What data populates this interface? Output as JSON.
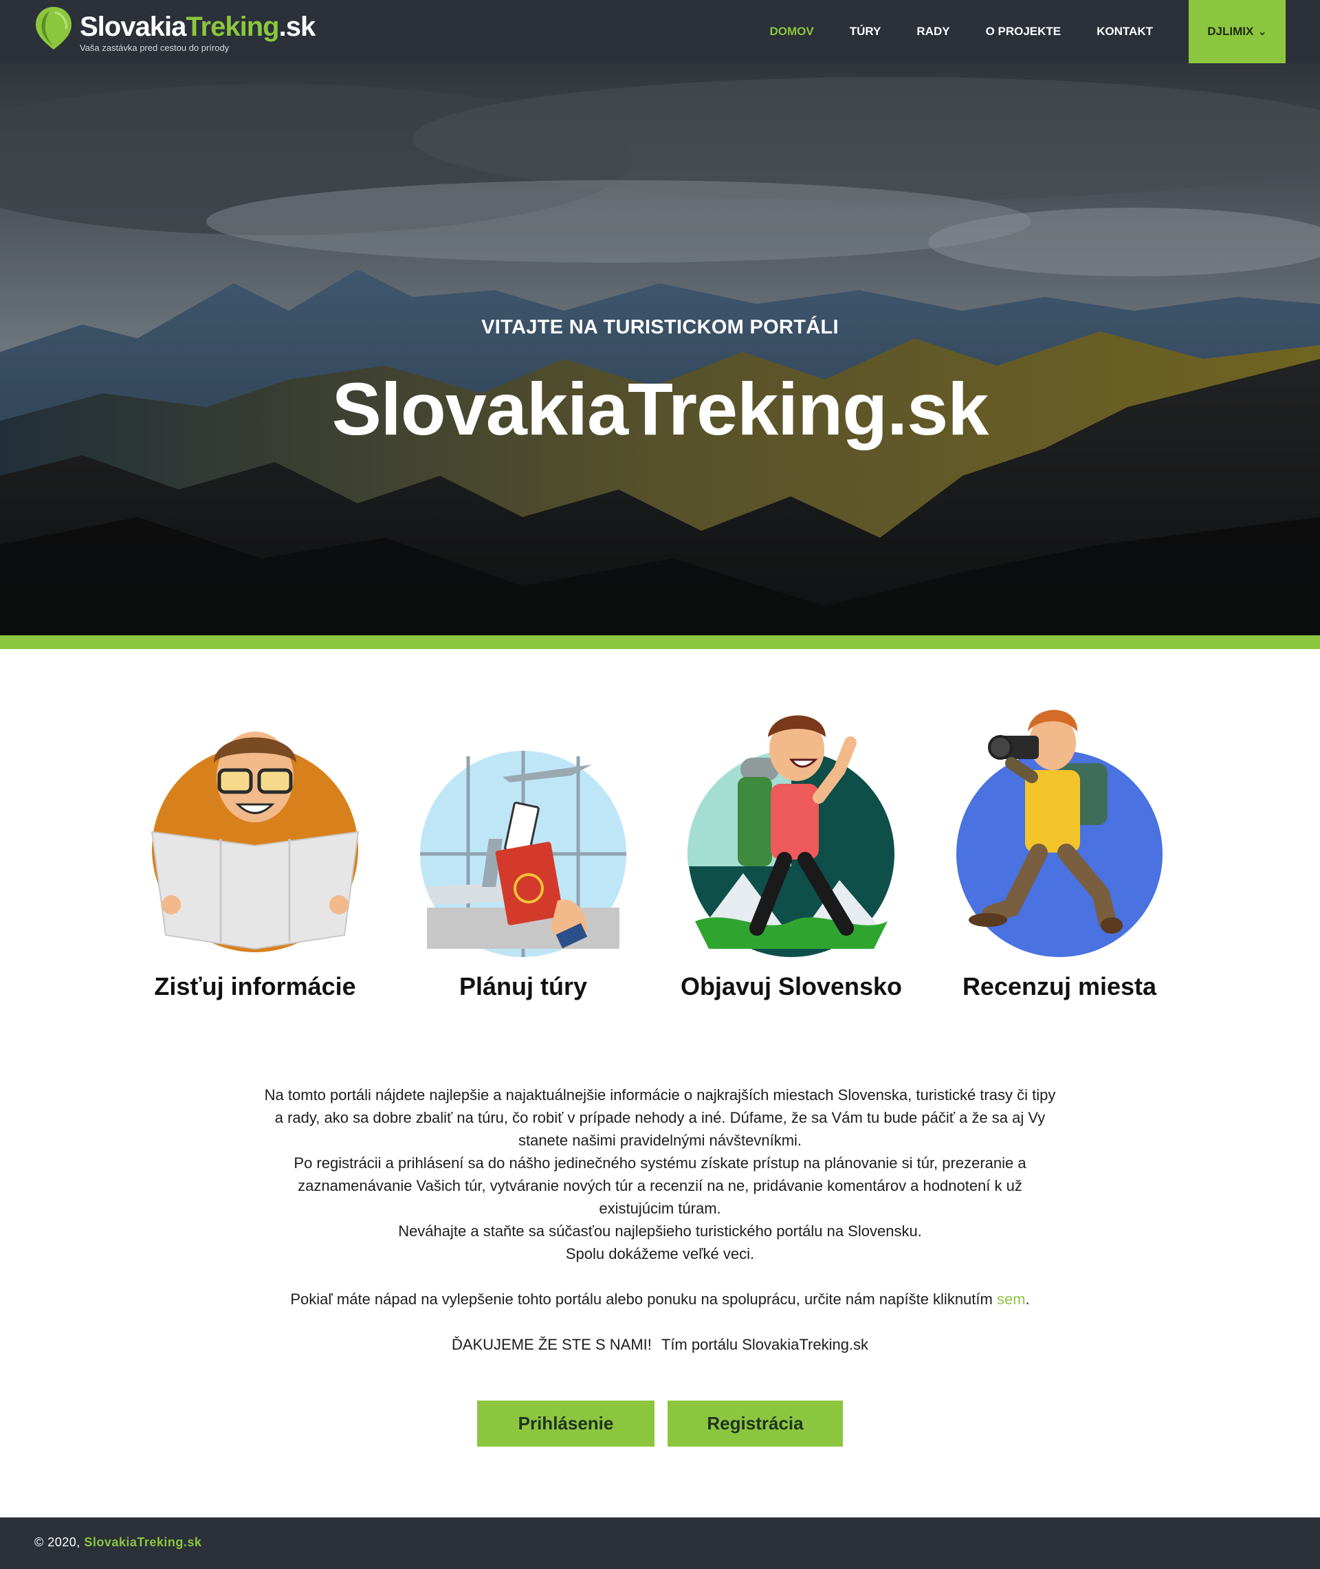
{
  "brand": {
    "name_part1": "Slovakia",
    "name_part2": "Treking",
    "name_part3": ".sk",
    "tagline": "Vaša zastávka pred cestou do prírody"
  },
  "nav": {
    "items": [
      "DOMOV",
      "TÚRY",
      "RADY",
      "O PROJEKTE",
      "KONTAKT"
    ],
    "active": "DOMOV",
    "user": "DJLIMIX"
  },
  "hero": {
    "subtitle": "VITAJTE NA TURISTICKOM PORTÁLI",
    "title": "SlovakiaTreking.sk"
  },
  "features": [
    {
      "label": "Zisťuj informácie",
      "icon": "reading-map-icon"
    },
    {
      "label": "Plánuj túry",
      "icon": "passport-ticket-icon"
    },
    {
      "label": "Objavuj Slovensko",
      "icon": "hiker-icon"
    },
    {
      "label": "Recenzuj miesta",
      "icon": "photographer-icon"
    }
  ],
  "about": {
    "p1_line1": "Na tomto portáli nájdete najlepšie a najaktuálnejšie informácie o najkrajších miestach Slovenska, turistické trasy či tipy",
    "p1_line2": "a rady, ako sa dobre zbaliť na túru, čo robiť v prípade nehody a iné. Dúfame, že sa Vám tu bude páčiť a že sa aj Vy",
    "p1_line3": "stanete našimi pravidelnými návštevníkmi.",
    "p2_line1": "Po registrácii a prihlásení sa do nášho jedinečného systému získate prístup na plánovanie si túr, prezeranie a",
    "p2_line2": "zaznamenávanie Vašich túr, vytváranie nových túr a recenzií na ne, pridávanie komentárov a hodnotení k už",
    "p2_line3": "existujúcim túram.",
    "p3": "Neváhajte a staňte sa súčasťou najlepšieho turistického portálu na Slovensku.",
    "p4": "Spolu dokážeme veľké veci.",
    "contact_before": "Pokiaľ máte nápad na vylepšenie tohto portálu alebo ponuku na spoluprácu, určite nám napíšte kliknutím ",
    "contact_link": "sem",
    "contact_after": ".",
    "thanks": "ĎAKUJEME ŽE STE S NAMI!",
    "team": "Tím portálu SlovakiaTreking.sk"
  },
  "buttons": {
    "login": "Prihlásenie",
    "register": "Registrácia"
  },
  "footer": {
    "copyright": "© 2020, ",
    "site": "SlovakiaTreking.sk"
  },
  "colors": {
    "accent": "#8cc63f",
    "dark": "#2b3039"
  }
}
